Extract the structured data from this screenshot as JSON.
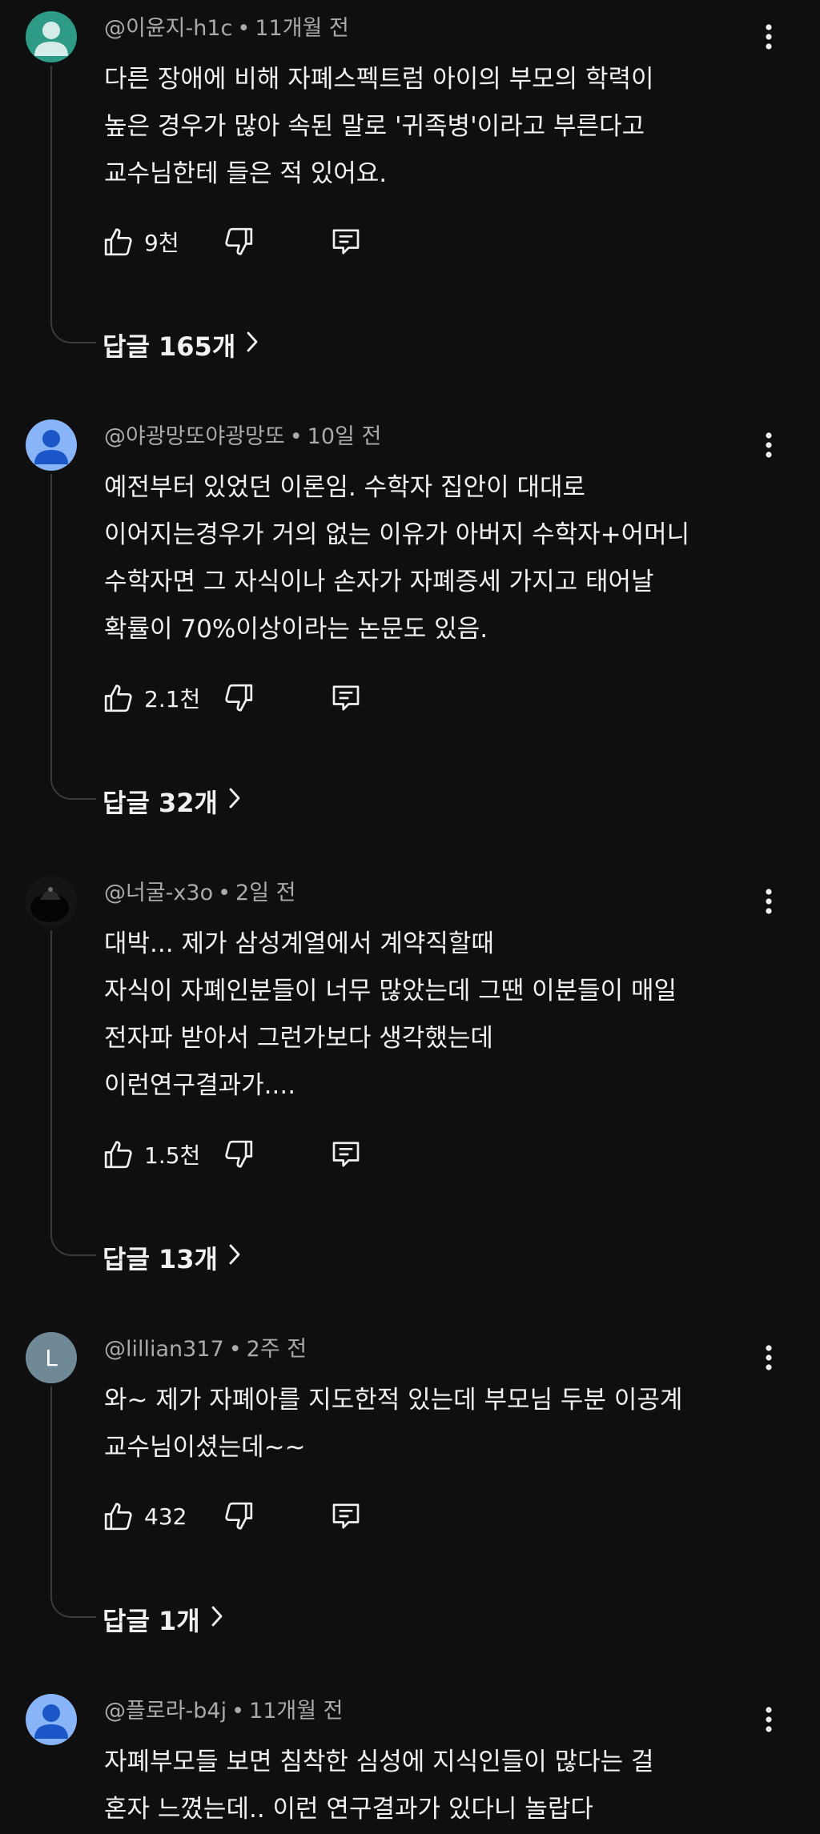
{
  "comments": [
    {
      "author": "@이윤지-h1c",
      "time": "11개월 전",
      "avatar": {
        "type": "person",
        "bg": "#2e9b86",
        "fg": "#d6ecea"
      },
      "lines": [
        "다른 장애에 비해 자폐스펙트럼 아이의 부모의 학력이",
        "높은 경우가 많아 속된 말로 '귀족병'이라고 부른다고",
        "교수님한테 들은 적 있어요."
      ],
      "likes": "9천",
      "replies": "답글 165개"
    },
    {
      "author": "@야광망또야광망또",
      "time": "10일 전",
      "avatar": {
        "type": "person",
        "bg": "#8ab4f8",
        "fg": "#1a56c8"
      },
      "lines": [
        "예전부터 있었던 이론임. 수학자 집안이 대대로",
        "이어지는경우가 거의 없는 이유가 아버지 수학자+어머니",
        "수학자면 그 자식이나 손자가 자폐증세 가지고 태어날",
        "확률이 70%이상이라는 논문도 있음."
      ],
      "likes": "2.1천",
      "replies": "답글 32개"
    },
    {
      "author": "@너굴-x3o",
      "time": "2일 전",
      "avatar": {
        "type": "photo",
        "bg": "#1c1c1c",
        "fg": "#3a3a3a"
      },
      "lines": [
        "대박... 제가 삼성계열에서 계약직할때",
        "자식이 자폐인분들이 너무 많았는데 그땐 이분들이 매일",
        "전자파 받아서 그런가보다 생각했는데",
        "이런연구결과가...."
      ],
      "likes": "1.5천",
      "replies": "답글 13개"
    },
    {
      "author": "@lillian317",
      "time": "2주 전",
      "avatar": {
        "type": "letter",
        "letter": "L",
        "bg": "#6f8a96",
        "fg": "#ffffff"
      },
      "lines": [
        "와~ 제가 자폐아를 지도한적 있는데 부모님 두분 이공계",
        "교수님이셨는데~~"
      ],
      "likes": "432",
      "replies": "답글 1개"
    },
    {
      "author": "@플로라-b4j",
      "time": "11개월 전",
      "avatar": {
        "type": "person",
        "bg": "#8ab4f8",
        "fg": "#1a56c8"
      },
      "lines": [
        "자폐부모들 보면  침착한 심성에 지식인들이 많다는 걸",
        "혼자 느꼈는데.. 이런 연구결과가 있다니 놀랍다"
      ]
    }
  ],
  "icons": {
    "like": "thumbs-up-icon",
    "dislike": "thumbs-down-icon",
    "reply": "reply-icon",
    "more": "more-vert-icon",
    "chevron": "chevron-right-icon"
  }
}
